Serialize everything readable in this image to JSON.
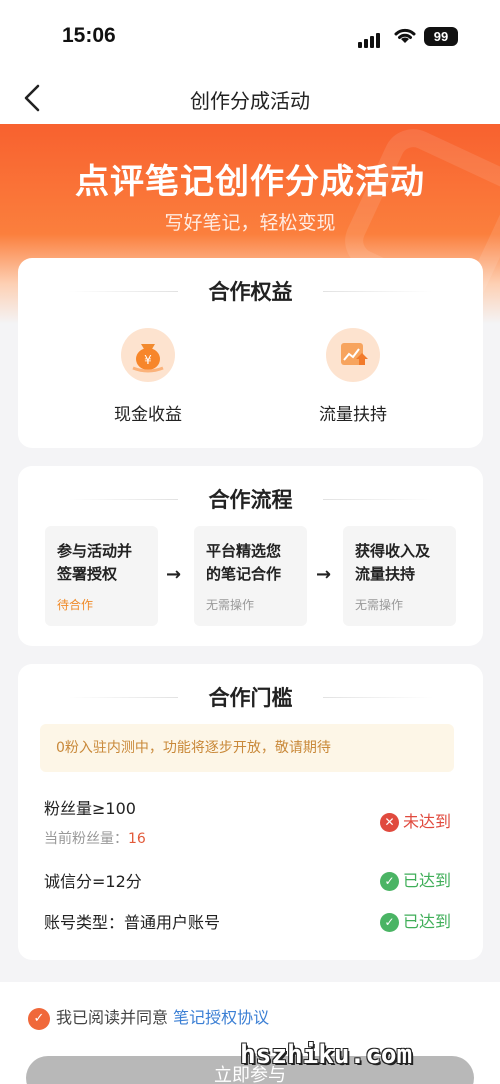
{
  "status_bar": {
    "time": "15:06",
    "battery": "99"
  },
  "nav": {
    "title": "创作分成活动"
  },
  "hero": {
    "title": "点评笔记创作分成活动",
    "subtitle": "写好笔记，轻松变现"
  },
  "benefits": {
    "title": "合作权益",
    "items": [
      {
        "icon": "money-bag-icon",
        "label": "现金收益"
      },
      {
        "icon": "traffic-chart-icon",
        "label": "流量扶持"
      }
    ]
  },
  "process": {
    "title": "合作流程",
    "steps": [
      {
        "title": "参与活动并签署授权",
        "status": "待合作"
      },
      {
        "title": "平台精选您的笔记合作",
        "status": "无需操作"
      },
      {
        "title": "获得收入及流量扶持",
        "status": "无需操作"
      }
    ],
    "arrow": "→"
  },
  "threshold": {
    "title": "合作门槛",
    "notice": "0粉入驻内测中，功能将逐步开放，敬请期待",
    "requirements": [
      {
        "label": "粉丝量≥100",
        "sub_label": "当前粉丝量：",
        "sub_value": "16",
        "status": "未达到",
        "met": false
      },
      {
        "label": "诚信分=12分",
        "status": "已达到",
        "met": true
      },
      {
        "label": "账号类型：普通用户账号",
        "status": "已达到",
        "met": true
      }
    ]
  },
  "footer": {
    "agree_text": "我已阅读并同意",
    "agree_link": "笔记授权协议",
    "submit_label": "立即参与"
  },
  "watermark": "hszhiku.com",
  "colors": {
    "accent": "#f8612f",
    "good": "#4ab464",
    "bad": "#e04a3e",
    "link": "#3b7fd4"
  }
}
